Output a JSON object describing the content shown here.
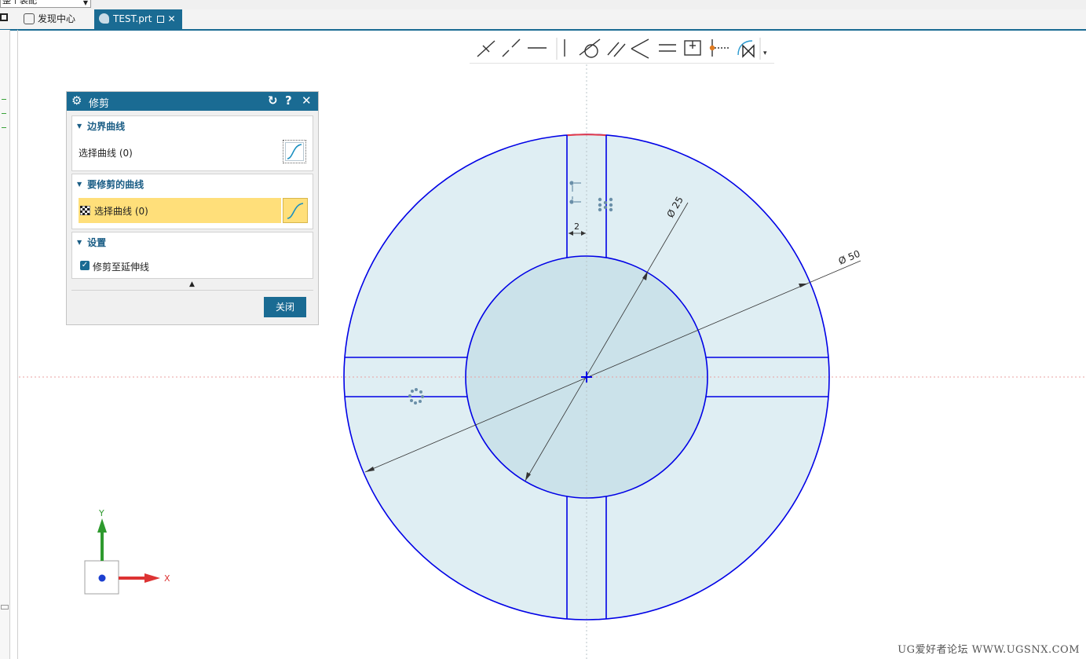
{
  "topbar": {
    "combo_value": "整个装配"
  },
  "tabs": [
    {
      "label": "发现中心",
      "active": false
    },
    {
      "label": "TEST.prt",
      "active": true,
      "close": "✕"
    }
  ],
  "sketch_toolbar": {
    "tools": [
      "point-on-curve-icon",
      "colinear-tangent-icon",
      "horizontal-icon",
      "vertical-icon",
      "tangent-icon",
      "parallel-icon",
      "perpendicular-icon",
      "equal-length-icon",
      "fixed-icon",
      "midpoint-icon",
      "auto-constraint-icon"
    ],
    "more": "▾"
  },
  "dialog": {
    "title": "修剪",
    "reset_icon": "↻",
    "help_icon": "?",
    "close_icon": "✕",
    "sections": {
      "boundary": {
        "header": "边界曲线",
        "select_label": "选择曲线 (0)"
      },
      "trim": {
        "header": "要修剪的曲线",
        "select_label": "选择曲线 (0)"
      },
      "settings": {
        "header": "设置",
        "checkbox_label": "修剪至延伸线",
        "checked": true
      }
    },
    "collapse_arrow": "▲",
    "close_button": "关闭"
  },
  "sketch": {
    "dim_outer": "Ø 50",
    "dim_inner": "Ø 25",
    "dim_slot": "2"
  },
  "axes": {
    "x_label": "X",
    "y_label": "Y"
  },
  "colors": {
    "accent": "#1a6b93",
    "highlight": "#ffdf7a",
    "sketch_line": "#0000e6",
    "fill": "#dfeef3"
  },
  "watermark": "UG爱好者论坛 WWW.UGSNX.COM"
}
